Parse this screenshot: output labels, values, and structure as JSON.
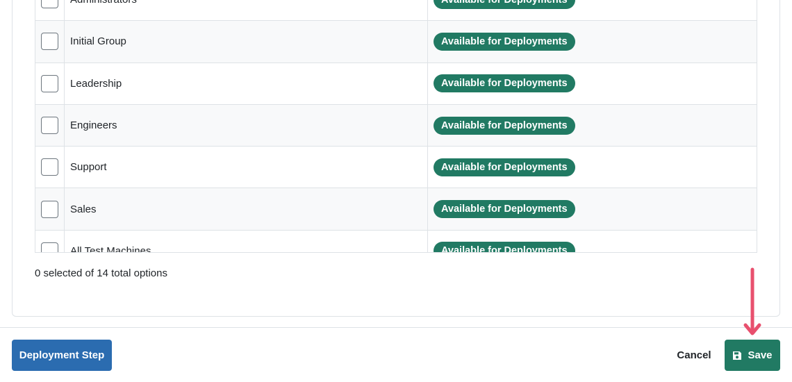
{
  "groups": {
    "rows": [
      {
        "name": "Administrators",
        "status": "Available for Deployments"
      },
      {
        "name": "Initial Group",
        "status": "Available for Deployments"
      },
      {
        "name": "Leadership",
        "status": "Available for Deployments"
      },
      {
        "name": "Engineers",
        "status": "Available for Deployments"
      },
      {
        "name": "Support",
        "status": "Available for Deployments"
      },
      {
        "name": "Sales",
        "status": "Available for Deployments"
      },
      {
        "name": "All Test Machines",
        "status": "Available for Deployments"
      }
    ]
  },
  "selection_summary": "0 selected of 14 total options",
  "footer": {
    "deployment_step_label": "Deployment Step",
    "cancel_label": "Cancel",
    "save_label": "Save"
  },
  "colors": {
    "badge": "#217a63",
    "save_button": "#217a63",
    "deployment_button": "#2b6cb0",
    "annotation_arrow": "#e8506e"
  },
  "icons": {
    "save": "floppy-disk-icon",
    "annotation": "arrow-down-annotation"
  }
}
